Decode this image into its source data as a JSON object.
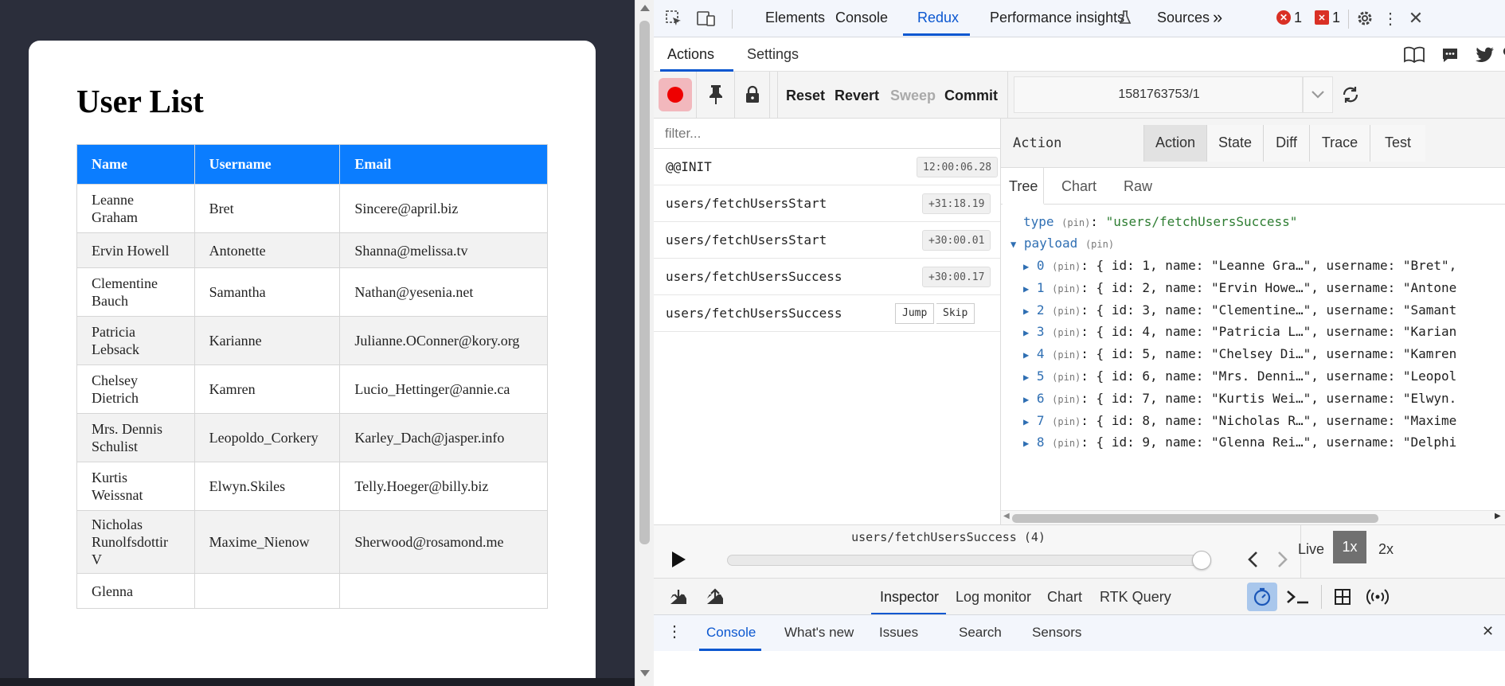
{
  "page": {
    "title": "User List",
    "columns": [
      "Name",
      "Username",
      "Email"
    ],
    "rows": [
      {
        "name": "Leanne Graham",
        "username": "Bret",
        "email": "Sincere@april.biz"
      },
      {
        "name": "Ervin Howell",
        "username": "Antonette",
        "email": "Shanna@melissa.tv"
      },
      {
        "name": "Clementine Bauch",
        "username": "Samantha",
        "email": "Nathan@yesenia.net"
      },
      {
        "name": "Patricia Lebsack",
        "username": "Karianne",
        "email": "Julianne.OConner@kory.org"
      },
      {
        "name": "Chelsey Dietrich",
        "username": "Kamren",
        "email": "Lucio_Hettinger@annie.ca"
      },
      {
        "name": "Mrs. Dennis Schulist",
        "username": "Leopoldo_Corkery",
        "email": "Karley_Dach@jasper.info"
      },
      {
        "name": "Kurtis Weissnat",
        "username": "Elwyn.Skiles",
        "email": "Telly.Hoeger@billy.biz"
      },
      {
        "name": "Nicholas Runolfsdottir V",
        "username": "Maxime_Nienow",
        "email": "Sherwood@rosamond.me"
      },
      {
        "name": "Glenna",
        "username": "",
        "email": ""
      }
    ]
  },
  "devtools": {
    "tabs": [
      "Elements",
      "Console",
      "Redux",
      "Performance insights",
      "Sources"
    ],
    "active_tab": "Redux",
    "error_count": "1",
    "issue_count": "1",
    "redux_tabs": [
      "Actions",
      "Settings"
    ],
    "toolbar": {
      "reset": "Reset",
      "revert": "Revert",
      "sweep": "Sweep",
      "commit": "Commit",
      "instance": "1581763753/1"
    },
    "filter_placeholder": "filter...",
    "actions": [
      {
        "name": "@@INIT",
        "time": "12:00:06.28"
      },
      {
        "name": "users/fetchUsersStart",
        "time": "+31:18.19"
      },
      {
        "name": "users/fetchUsersStart",
        "time": "+30:00.01"
      },
      {
        "name": "users/fetchUsersSuccess",
        "time": "+30:00.17"
      },
      {
        "name": "users/fetchUsersSuccess",
        "jump": "Jump",
        "skip": "Skip"
      }
    ],
    "detail": {
      "title": "Action",
      "tabs": [
        "Action",
        "State",
        "Diff",
        "Trace",
        "Test"
      ],
      "view_tabs": [
        "Tree",
        "Chart",
        "Raw"
      ],
      "type_key": "type",
      "pin": "(pin)",
      "type_value": "\"users/fetchUsersSuccess\"",
      "payload_key": "payload",
      "payload_items": [
        {
          "idx": "0",
          "text": "{ id: 1, name: \"Leanne Gra…\", username: \"Bret\","
        },
        {
          "idx": "1",
          "text": "{ id: 2, name: \"Ervin Howe…\", username: \"Antone"
        },
        {
          "idx": "2",
          "text": "{ id: 3, name: \"Clementine…\", username: \"Samant"
        },
        {
          "idx": "3",
          "text": "{ id: 4, name: \"Patricia L…\", username: \"Karian"
        },
        {
          "idx": "4",
          "text": "{ id: 5, name: \"Chelsey Di…\", username: \"Kamren"
        },
        {
          "idx": "5",
          "text": "{ id: 6, name: \"Mrs. Denni…\", username: \"Leopol"
        },
        {
          "idx": "6",
          "text": "{ id: 7, name: \"Kurtis Wei…\", username: \"Elwyn."
        },
        {
          "idx": "7",
          "text": "{ id: 8, name: \"Nicholas R…\", username: \"Maxime"
        },
        {
          "idx": "8",
          "text": "{ id: 9, name: \"Glenna Rei…\", username: \"Delphi"
        }
      ]
    },
    "slider": {
      "label": "users/fetchUsersSuccess (4)",
      "position": 1.0,
      "live": "Live",
      "speed_1x": "1x",
      "speed_2x": "2x"
    },
    "monitors": [
      "Inspector",
      "Log monitor",
      "Chart",
      "RTK Query"
    ],
    "active_monitor": "Inspector",
    "drawer_tabs": [
      "Console",
      "What's new",
      "Issues",
      "Search",
      "Sensors"
    ],
    "active_drawer_tab": "Console"
  }
}
